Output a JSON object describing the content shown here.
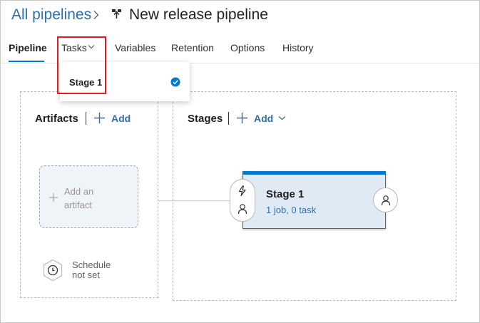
{
  "header": {
    "breadcrumb": "All pipelines",
    "title": "New release pipeline"
  },
  "tabs": [
    {
      "label": "Pipeline",
      "active": true
    },
    {
      "label": "Tasks",
      "active": false
    },
    {
      "label": "Variables",
      "active": false
    },
    {
      "label": "Retention",
      "active": false
    },
    {
      "label": "Options",
      "active": false
    },
    {
      "label": "History",
      "active": false
    }
  ],
  "tasks_dropdown": {
    "items": [
      {
        "label": "Stage 1",
        "selected": true
      }
    ]
  },
  "artifacts": {
    "title": "Artifacts",
    "add_label": "Add",
    "placeholder_line1": "Add an",
    "placeholder_line2": "artifact",
    "schedule_line1": "Schedule",
    "schedule_line2": "not set"
  },
  "stages": {
    "title": "Stages",
    "add_label": "Add",
    "items": [
      {
        "name": "Stage 1",
        "subtitle": "1 job, 0 task"
      }
    ]
  },
  "colors": {
    "accent": "#0078d4",
    "link": "#2f6ead",
    "highlight": "#e01a22",
    "stage_fill": "#dfeaf5"
  },
  "icons": [
    "chevron-right-icon",
    "pipeline-icon",
    "chevron-down-icon",
    "check-circle-icon",
    "plus-icon",
    "clock-icon",
    "lightning-icon",
    "person-icon"
  ]
}
